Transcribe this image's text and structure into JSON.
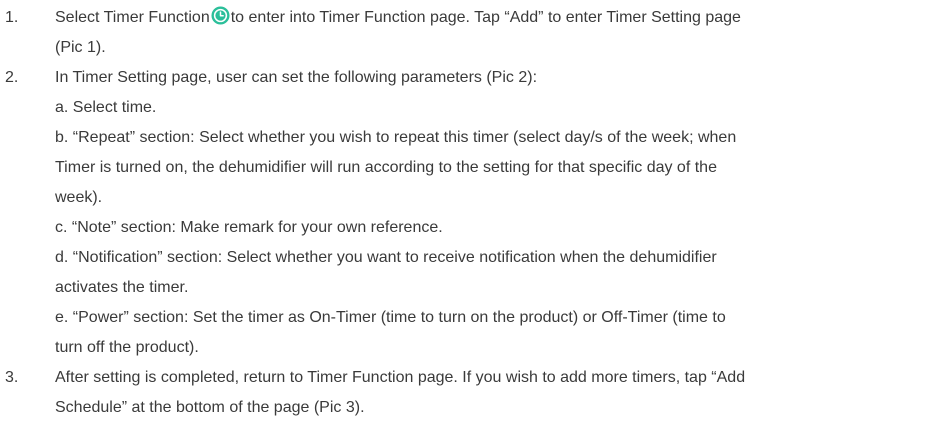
{
  "steps": [
    {
      "number": "1.",
      "line1_before_icon": "Select Timer Function",
      "icon": "clock-icon",
      "line1_after_icon": "to enter into Timer Function page. Tap “Add” to enter Timer Setting page",
      "line2": "(Pic 1)."
    },
    {
      "number": "2.",
      "line1": "In Timer Setting page, user can set the following parameters (Pic 2):",
      "items": {
        "a": "a. Select time.",
        "b_line1": "b. “Repeat” section: Select whether you wish to repeat this timer (select day/s of the week; when",
        "b_line2": "Timer is turned on, the dehumidifier will run according to the setting for that specific day of the",
        "b_line3": "week).",
        "c": "c. “Note” section: Make remark for your own reference.",
        "d_line1": "d. “Notification” section: Select whether you want to receive notification when the dehumidifier",
        "d_line2": "activates the timer.",
        "e_line1": "e. “Power” section: Set the timer as On-Timer (time to turn on the product) or Off-Timer (time to",
        "e_line2": "turn off the product)."
      }
    },
    {
      "number": "3.",
      "line1": "After setting is completed, return to Timer Function page. If you wish to add more timers, tap “Add",
      "line2": "Schedule” at the bottom of the page (Pic 3)."
    }
  ],
  "colors": {
    "text": "#3a3a3a",
    "icon_fill": "#2bbf9a"
  }
}
